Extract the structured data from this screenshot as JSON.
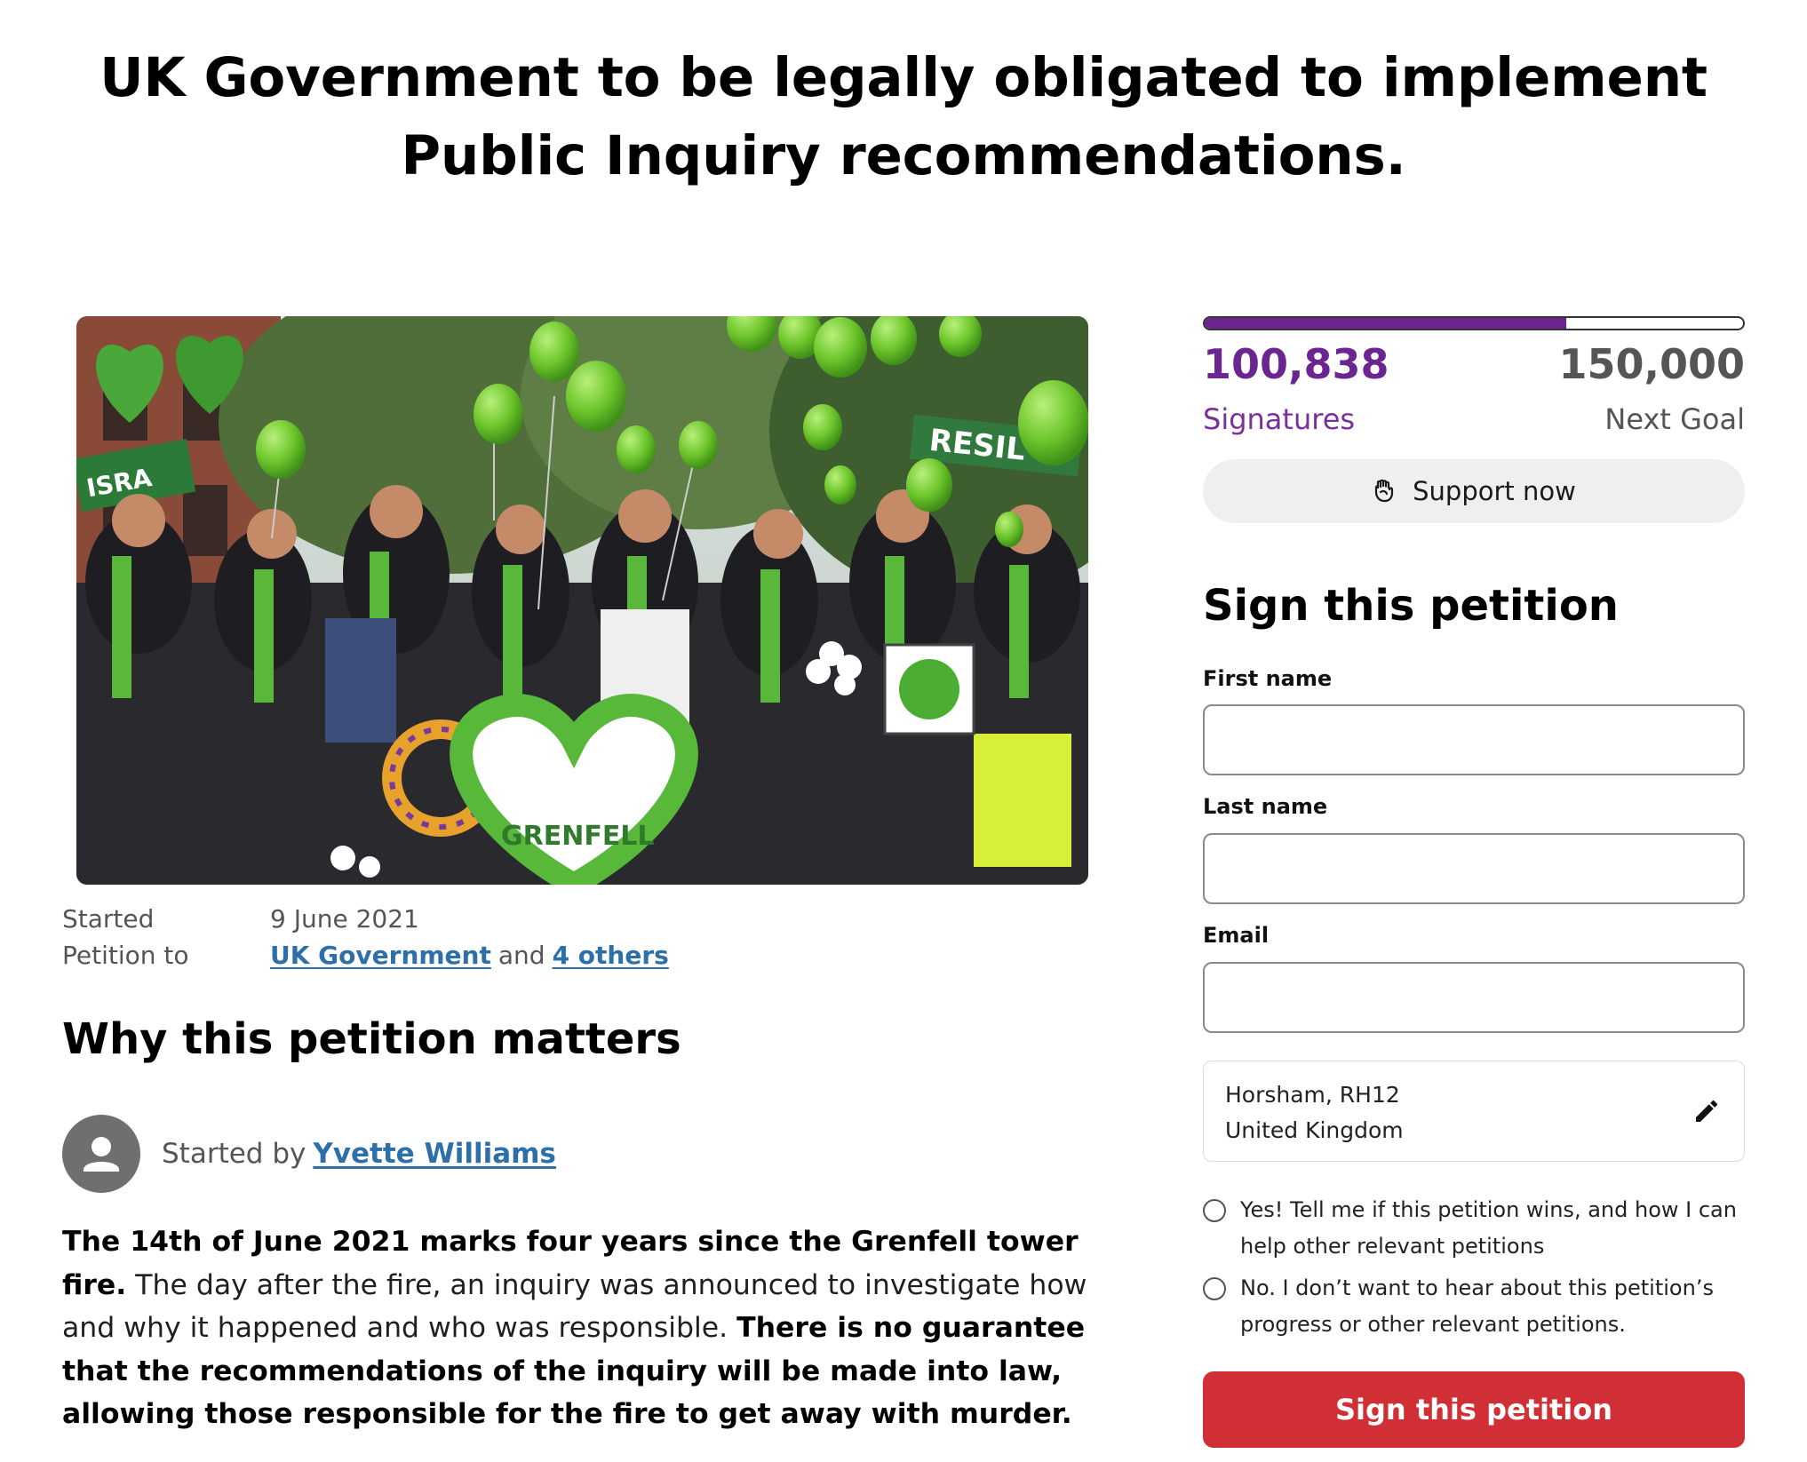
{
  "title": "UK Government to be legally obligated to implement Public Inquiry recommendations.",
  "hero": {
    "image_alt": "Grenfell memorial crowd releasing green balloons",
    "banner_text": "RESIL",
    "heart_text": "GRENFELL",
    "sign_text": "ISRA"
  },
  "meta": {
    "started_label": "Started",
    "started_value": "9 June 2021",
    "petition_to_label": "Petition to",
    "target_link": "UK Government",
    "and_text": "and",
    "others_link": "4 others"
  },
  "why": {
    "heading": "Why this petition matters",
    "started_by_label": "Started by",
    "author": "Yvette Williams",
    "p1_bold": "The 14th of June 2021 marks four years since the Grenfell tower fire.",
    "p1_normal": " The day after the fire, an inquiry was announced to investigate how and why it happened and who was responsible.  ",
    "p2_bold": "There is no guarantee that the recommendations of the inquiry will be made into law, allowing those responsible for the fire to get away with murder."
  },
  "progress": {
    "signatures": "100,838",
    "goal": "150,000",
    "signatures_label": "Signatures",
    "goal_label": "Next Goal",
    "fraction": 0.672,
    "color": "#6b2590"
  },
  "support": {
    "label": "Support now",
    "icon": "fist-icon"
  },
  "form": {
    "heading": "Sign this petition",
    "first_name_label": "First name",
    "first_name_value": "",
    "last_name_label": "Last name",
    "last_name_value": "",
    "email_label": "Email",
    "email_value": "",
    "location_line1": "Horsham, RH12",
    "location_line2": "United Kingdom",
    "radio_yes": "Yes! Tell me if this petition wins, and how I can help other relevant petitions",
    "radio_no": "No. I don’t want to hear about this petition’s progress or other relevant petitions.",
    "submit_label": "Sign this petition",
    "submit_color": "#d02f35"
  }
}
